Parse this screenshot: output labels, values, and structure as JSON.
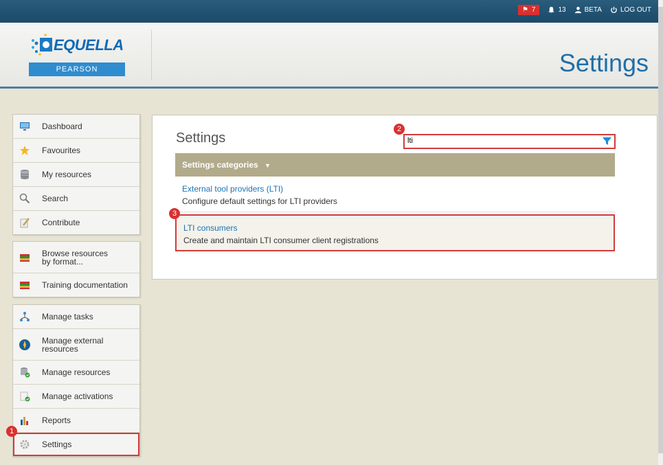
{
  "topbar": {
    "flag_count": "7",
    "notif_count": "13",
    "user_label": "BETA",
    "logout_label": "LOG OUT"
  },
  "header": {
    "logo_text": "EQUELLA",
    "logo_sub": "PEARSON",
    "page_title": "Settings"
  },
  "nav": {
    "group1": [
      {
        "label": "Dashboard",
        "icon": "monitor-icon"
      },
      {
        "label": "Favourites",
        "icon": "star-icon"
      },
      {
        "label": "My resources",
        "icon": "database-icon"
      },
      {
        "label": "Search",
        "icon": "magnifier-icon"
      },
      {
        "label": "Contribute",
        "icon": "pencil-icon"
      }
    ],
    "group2": [
      {
        "label": "Browse resources by format...",
        "icon": "books-icon"
      },
      {
        "label": "Training documentation",
        "icon": "books-icon"
      }
    ],
    "group3": [
      {
        "label": "Manage tasks",
        "icon": "workflow-icon"
      },
      {
        "label": "Manage external resources",
        "icon": "compass-icon"
      },
      {
        "label": "Manage resources",
        "icon": "database-check-icon"
      },
      {
        "label": "Manage activations",
        "icon": "clipboard-check-icon"
      },
      {
        "label": "Reports",
        "icon": "bar-chart-icon"
      },
      {
        "label": "Settings",
        "icon": "gear-icon"
      }
    ]
  },
  "main": {
    "title": "Settings",
    "filter_value": "lti",
    "categories_header": "Settings categories",
    "rows": [
      {
        "link": "External tool providers (LTI)",
        "desc": "Configure default settings for LTI providers"
      },
      {
        "link": "LTI consumers",
        "desc": "Create and maintain LTI consumer client registrations"
      }
    ]
  },
  "markers": {
    "m1": "1",
    "m2": "2",
    "m3": "3"
  },
  "colors": {
    "accent": "#1e6fa8",
    "highlight": "#d23b3b",
    "category_header": "#b1ab8c"
  }
}
